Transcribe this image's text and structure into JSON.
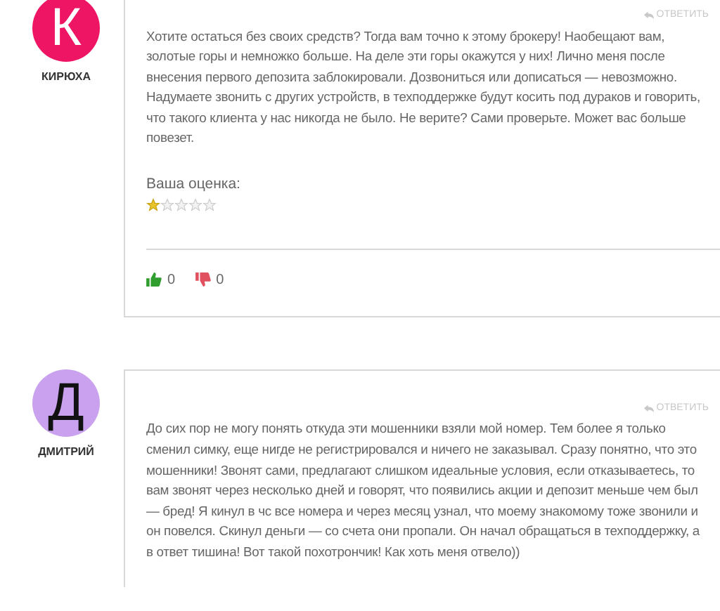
{
  "comments": [
    {
      "avatar": {
        "letter": "К",
        "color": "#ee1565"
      },
      "author": "КИРЮХА",
      "reply": "ОТВЕТИТЬ",
      "text": "Хотите остаться без своих средств? Тогда вам точно к этому брокеру! Наобещают вам, золотые горы и немножко больше. На деле эти горы окажутся у них! Лично меня после внесения первого депозита заблокировали. Дозвониться или дописаться — невозможно. Надумаете звонить с других устройств, в техподдержке будут косить под дураков и говорить, что такого клиента у нас никогда не было. Не верите? Сами проверьте. Может вас больше повезет.",
      "rating": {
        "label": "Ваша оценка:",
        "stars": 1
      },
      "likes": "0",
      "dislikes": "0"
    },
    {
      "avatar": {
        "letter": "Д",
        "color": "#c9a1ee"
      },
      "author": "ДМИТРИЙ",
      "reply": "ОТВЕТИТЬ",
      "text": "До сих пор не могу понять откуда эти мошенники взяли мой номер. Тем более я только сменил симку, еще нигде не регистрировался и ничего не заказывал. Сразу понятно, что это мошенники! Звонят сами, предлагают слишком идеальные условия, если отказываетесь, то вам звонят через несколько дней и говорят, что появились акции и депозит меньше чем был — бред! Я кинул в чс все номера и через месяц узнал, что моему знакомому тоже звонили и он повелся. Скинул деньги — со счета они пропали. Он начал обращаться в техподдержку, а в ответ тишина! Вот такой похотрончик! Как хоть меня отвело))"
    }
  ]
}
